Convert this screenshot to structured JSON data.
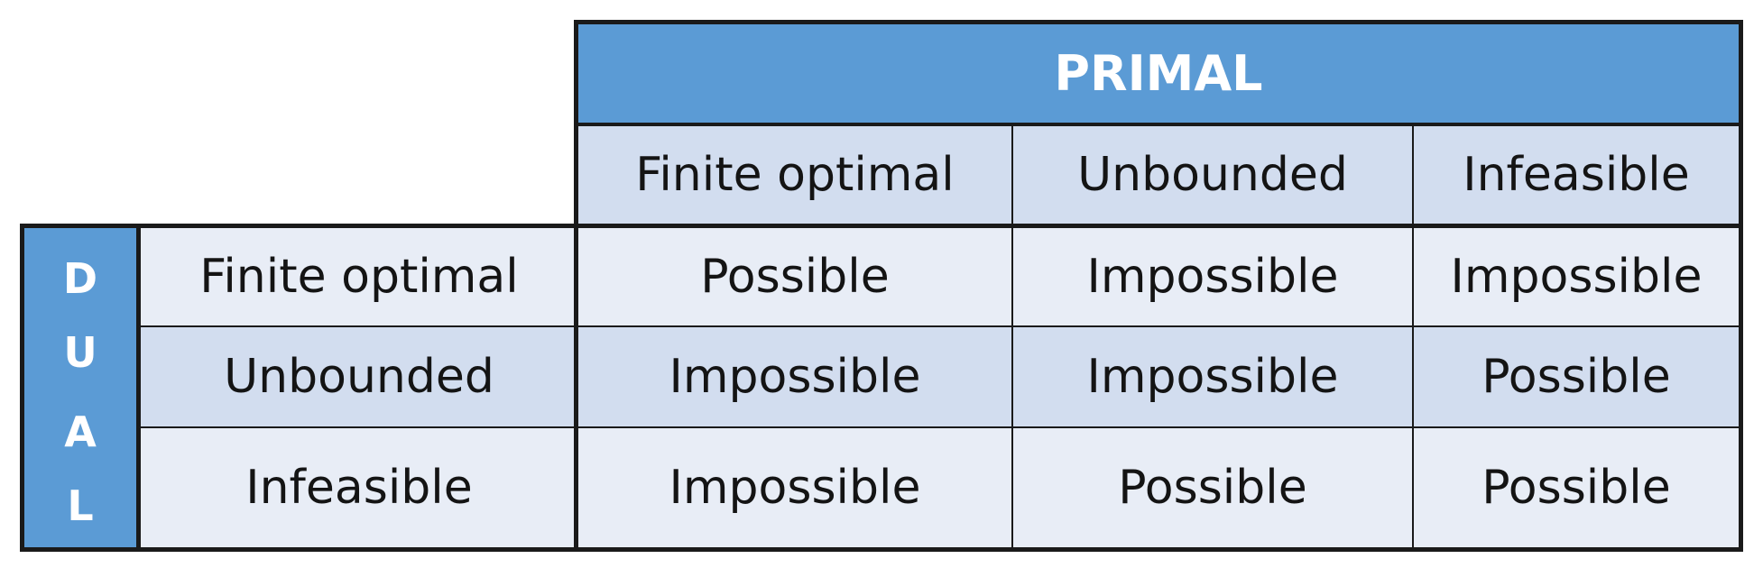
{
  "primal_label": "PRIMAL",
  "dual_letters": [
    "D",
    "U",
    "A",
    "L"
  ],
  "columns": [
    "Finite optimal",
    "Unbounded",
    "Infeasible"
  ],
  "rows": [
    {
      "label": "Finite optimal",
      "cells": [
        "Possible",
        "Impossible",
        "Impossible"
      ]
    },
    {
      "label": "Unbounded",
      "cells": [
        "Impossible",
        "Impossible",
        "Possible"
      ]
    },
    {
      "label": "Infeasible",
      "cells": [
        "Impossible",
        "Possible",
        "Possible"
      ]
    }
  ],
  "colors": {
    "header_blue": "#5b9bd5",
    "shade_dark": "#d2ddef",
    "shade_light": "#e8edf6",
    "border": "#1a1a1a"
  }
}
